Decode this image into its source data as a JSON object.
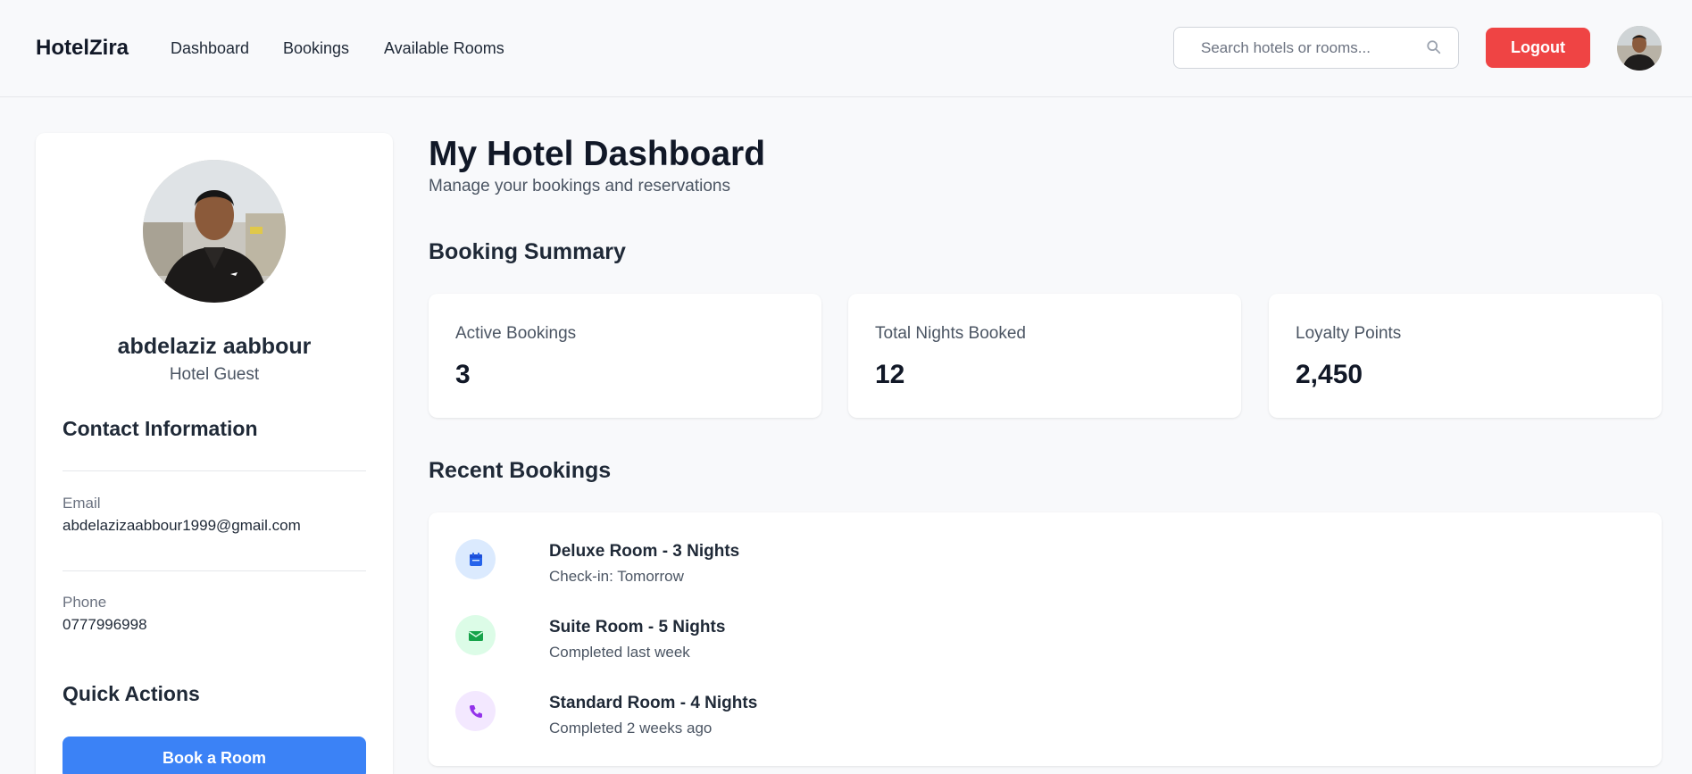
{
  "navbar": {
    "brand": "HotelZira",
    "links": [
      "Dashboard",
      "Bookings",
      "Available Rooms"
    ],
    "search_placeholder": "Search hotels or rooms...",
    "logout_label": "Logout"
  },
  "profile": {
    "name": "abdelaziz aabbour",
    "role": "Hotel Guest",
    "contact_title": "Contact Information",
    "email_label": "Email",
    "email": "abdelazizaabbour1999@gmail.com",
    "phone_label": "Phone",
    "phone": "0777996998",
    "quick_actions_title": "Quick Actions",
    "book_button": "Book a Room"
  },
  "main": {
    "title": "My Hotel Dashboard",
    "subtitle": "Manage your bookings and reservations",
    "summary_title": "Booking Summary",
    "stats": [
      {
        "label": "Active Bookings",
        "value": "3"
      },
      {
        "label": "Total Nights Booked",
        "value": "12"
      },
      {
        "label": "Loyalty Points",
        "value": "2,450"
      }
    ],
    "recent_title": "Recent Bookings",
    "bookings": [
      {
        "title": "Deluxe Room - 3 Nights",
        "subtitle": "Check-in: Tomorrow",
        "icon": "calendar-icon",
        "icon_color": "#2563eb",
        "icon_bg": "#dbeafe"
      },
      {
        "title": "Suite Room - 5 Nights",
        "subtitle": "Completed last week",
        "icon": "envelope-icon",
        "icon_color": "#16a34a",
        "icon_bg": "#dcfce7"
      },
      {
        "title": "Standard Room - 4 Nights",
        "subtitle": "Completed 2 weeks ago",
        "icon": "phone-icon",
        "icon_color": "#9333ea",
        "icon_bg": "#f3e8ff"
      }
    ]
  },
  "colors": {
    "accent": "#3b82f6",
    "danger": "#ef4444",
    "background": "#f8f9fb"
  }
}
